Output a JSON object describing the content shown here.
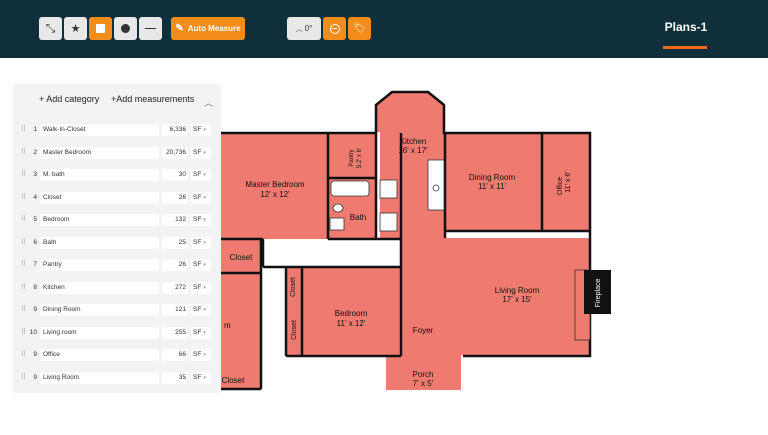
{
  "toolbar": {
    "tools": [
      {
        "name": "collapse-tool-icon",
        "glyph": "⤡"
      },
      {
        "name": "star-icon",
        "glyph": "★"
      },
      {
        "name": "rectangle-tool-icon",
        "glyph": "■"
      },
      {
        "name": "circle-tool-icon",
        "glyph": "●"
      },
      {
        "name": "line-tool-icon",
        "glyph": "—"
      }
    ],
    "auto_measure_label": "Auto Measure",
    "rotation_value": "0°",
    "colors": {
      "bar": "#0f2f3a",
      "accent": "#f28c1a",
      "underline": "#f26a1b"
    }
  },
  "tabs": {
    "active": "Plans-1"
  },
  "panel": {
    "add_category": "+ Add category",
    "add_measurements": "+Add measurements",
    "rows": [
      {
        "num": "1",
        "name": "Walk-In-Closet",
        "value": "6,336",
        "unit": "SF"
      },
      {
        "num": "2",
        "name": "Master Bedroom",
        "value": "20,736",
        "unit": "SF"
      },
      {
        "num": "3",
        "name": "M. bath",
        "value": "30",
        "unit": "SF"
      },
      {
        "num": "4",
        "name": "Closet",
        "value": "26",
        "unit": "SF"
      },
      {
        "num": "5",
        "name": "Bedroom",
        "value": "132",
        "unit": "SF"
      },
      {
        "num": "6",
        "name": "Bath",
        "value": "25",
        "unit": "SF"
      },
      {
        "num": "7",
        "name": "Pantry",
        "value": "26",
        "unit": "SF"
      },
      {
        "num": "8",
        "name": "Kitchen",
        "value": "272",
        "unit": "SF"
      },
      {
        "num": "9",
        "name": "Dining Room",
        "value": "121",
        "unit": "SF"
      },
      {
        "num": "10",
        "name": "Living room",
        "value": "255",
        "unit": "SF"
      },
      {
        "num": "9",
        "name": "Office",
        "value": "66",
        "unit": "SF"
      },
      {
        "num": "9",
        "name": "Living Room",
        "value": "35",
        "unit": "SF"
      }
    ]
  },
  "floorplan": {
    "fill": "#ef7a6f",
    "labels": {
      "master_bedroom": "Master Bedroom",
      "master_bedroom_size": "12' x 12'",
      "pantry": "Pantry",
      "pantry_size": "5.2' x 6'",
      "kitchen": "Kitchen",
      "kitchen_size": "16' x 17'",
      "dining": "Dining Room",
      "dining_size": "11' x 11'",
      "office": "Office",
      "office_size": "11' x 6'",
      "bath": "Bath",
      "closet_top": "Closet",
      "closet_v1": "Closet",
      "closet_v2": "Closet",
      "closet_bottom": "Closet",
      "bedroom": "Bedroom",
      "bedroom_size": "11' x 12'",
      "foyer": "Foyer",
      "living": "Living Room",
      "living_size": "17' x 15'",
      "fireplace": "Fireplace",
      "porch": "Porch",
      "porch_size": "7' x 5'",
      "partial_m": "m"
    }
  }
}
